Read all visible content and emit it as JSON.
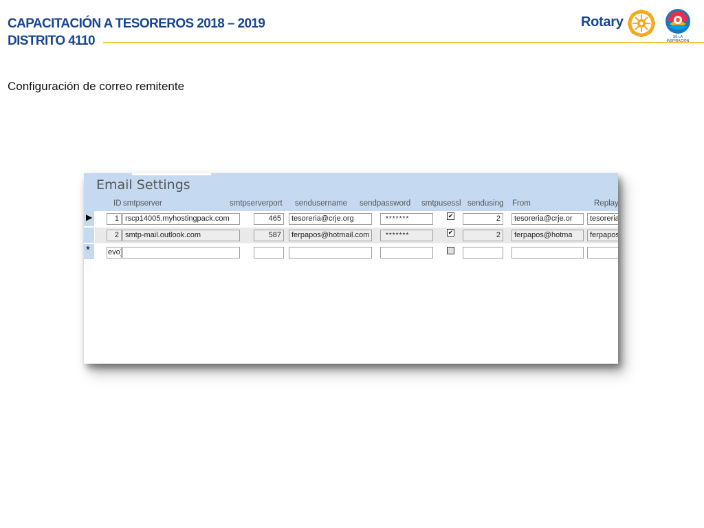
{
  "header": {
    "title_line1": "CAPACITACIÓN A TESOREROS 2018 – 2019",
    "title_line2": "DISTRITO 4110",
    "brand": "Rotary",
    "theme_tagline": "SÉ LA INSPIRACIÓN"
  },
  "subtitle": "Configuración de correo remitente",
  "form": {
    "title": "Email Settings",
    "columns": [
      "ID",
      "smtpserver",
      "smtpserverport",
      "sendusername",
      "sendpassword",
      "smtpusessl",
      "sendusing",
      "From",
      "Replay"
    ],
    "rows": [
      {
        "id": "1",
        "smtpserver": "rscp14005.myhostingpack.com",
        "smtpserverport": "465",
        "sendusername": "tesoreria@crje.org",
        "sendpassword": "*******",
        "smtpusessl": true,
        "sendusing": "2",
        "from": "tesoreria@crje.or",
        "replay": "tesoreria"
      },
      {
        "id": "2",
        "smtpserver": "smtp-mail.outlook.com",
        "smtpserverport": "587",
        "sendusername": "ferpapos@hotmail.com",
        "sendpassword": "*******",
        "smtpusessl": true,
        "sendusing": "2",
        "from": "ferpapos@hotma",
        "replay": "ferpapos"
      }
    ],
    "new_row": {
      "id": "evo)"
    },
    "record_markers": {
      "current": "▶",
      "new": "*"
    }
  },
  "colors": {
    "brand_blue": "#17458f",
    "gold_rule": "#f7c73e",
    "form_header_bg": "#c5d9f1"
  },
  "icons": [
    "rotary-wheel-icon",
    "theme-logo-icon",
    "checkbox-icon"
  ]
}
